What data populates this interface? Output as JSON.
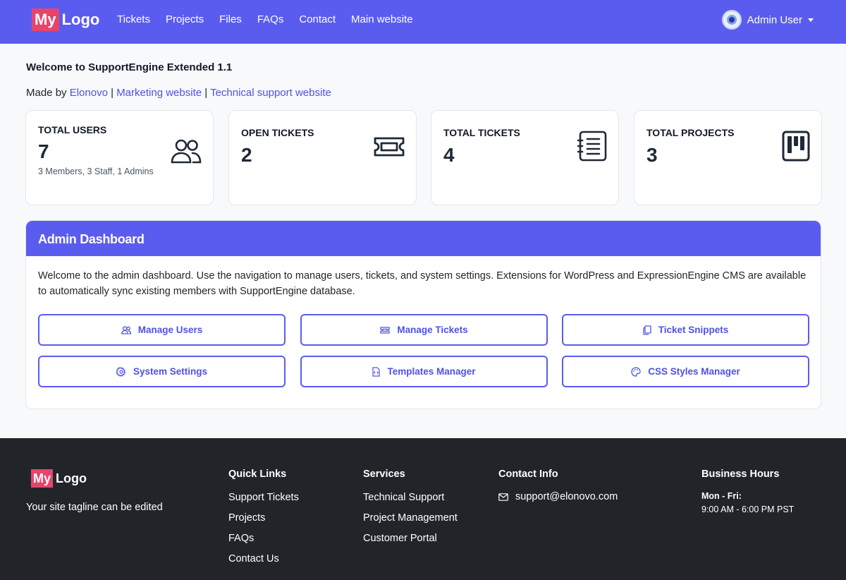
{
  "navbar": {
    "logo_my": "My",
    "logo_word": "Logo",
    "links": [
      "Tickets",
      "Projects",
      "Files",
      "FAQs",
      "Contact",
      "Main website"
    ],
    "user_name": "Admin User"
  },
  "header": {
    "welcome_title": "Welcome to SupportEngine Extended 1.1",
    "made_by_prefix": "Made by",
    "made_by_link": "Elonovo",
    "marketing_link": "Marketing website",
    "support_link": "Technical support website",
    "separator": "|"
  },
  "stats": [
    {
      "label": "TOTAL USERS",
      "value": "7",
      "sub": "3 Members, 3 Staff, 1 Admins",
      "icon": "users-icon"
    },
    {
      "label": "OPEN TICKETS",
      "value": "2",
      "icon": "ticket-icon"
    },
    {
      "label": "TOTAL TICKETS",
      "value": "4",
      "icon": "list-icon"
    },
    {
      "label": "TOTAL PROJECTS",
      "value": "3",
      "icon": "kanban-icon"
    }
  ],
  "dashboard": {
    "title": "Admin Dashboard",
    "description": "Welcome to the admin dashboard. Use the navigation to manage users, tickets, and system settings. Extensions for WordPress and ExpressionEngine CMS are available to automatically sync existing members with SupportEngine database.",
    "buttons": [
      {
        "label": "Manage Users",
        "icon": "users-icon"
      },
      {
        "label": "Manage Tickets",
        "icon": "ticket-icon"
      },
      {
        "label": "Ticket Snippets",
        "icon": "copy-icon"
      },
      {
        "label": "System Settings",
        "icon": "gear-icon"
      },
      {
        "label": "Templates Manager",
        "icon": "file-code-icon"
      },
      {
        "label": "CSS Styles Manager",
        "icon": "palette-icon"
      }
    ]
  },
  "footer": {
    "logo_my": "My",
    "logo_word": "Logo",
    "tagline": "Your site tagline can be edited",
    "quick_links": {
      "title": "Quick Links",
      "items": [
        "Support Tickets",
        "Projects",
        "FAQs",
        "Contact Us"
      ]
    },
    "services": {
      "title": "Services",
      "items": [
        "Technical Support",
        "Project Management",
        "Customer Portal"
      ]
    },
    "contact": {
      "title": "Contact Info",
      "email": "support@elonovo.com"
    },
    "hours": {
      "title": "Business Hours",
      "days": "Mon - Fri:",
      "time": "9:00 AM - 6:00 PM PST"
    }
  },
  "colors": {
    "primary": "#5a5cf0",
    "logo_accent": "#e8446b",
    "footer_bg": "#212529",
    "link": "#4f51e6"
  }
}
